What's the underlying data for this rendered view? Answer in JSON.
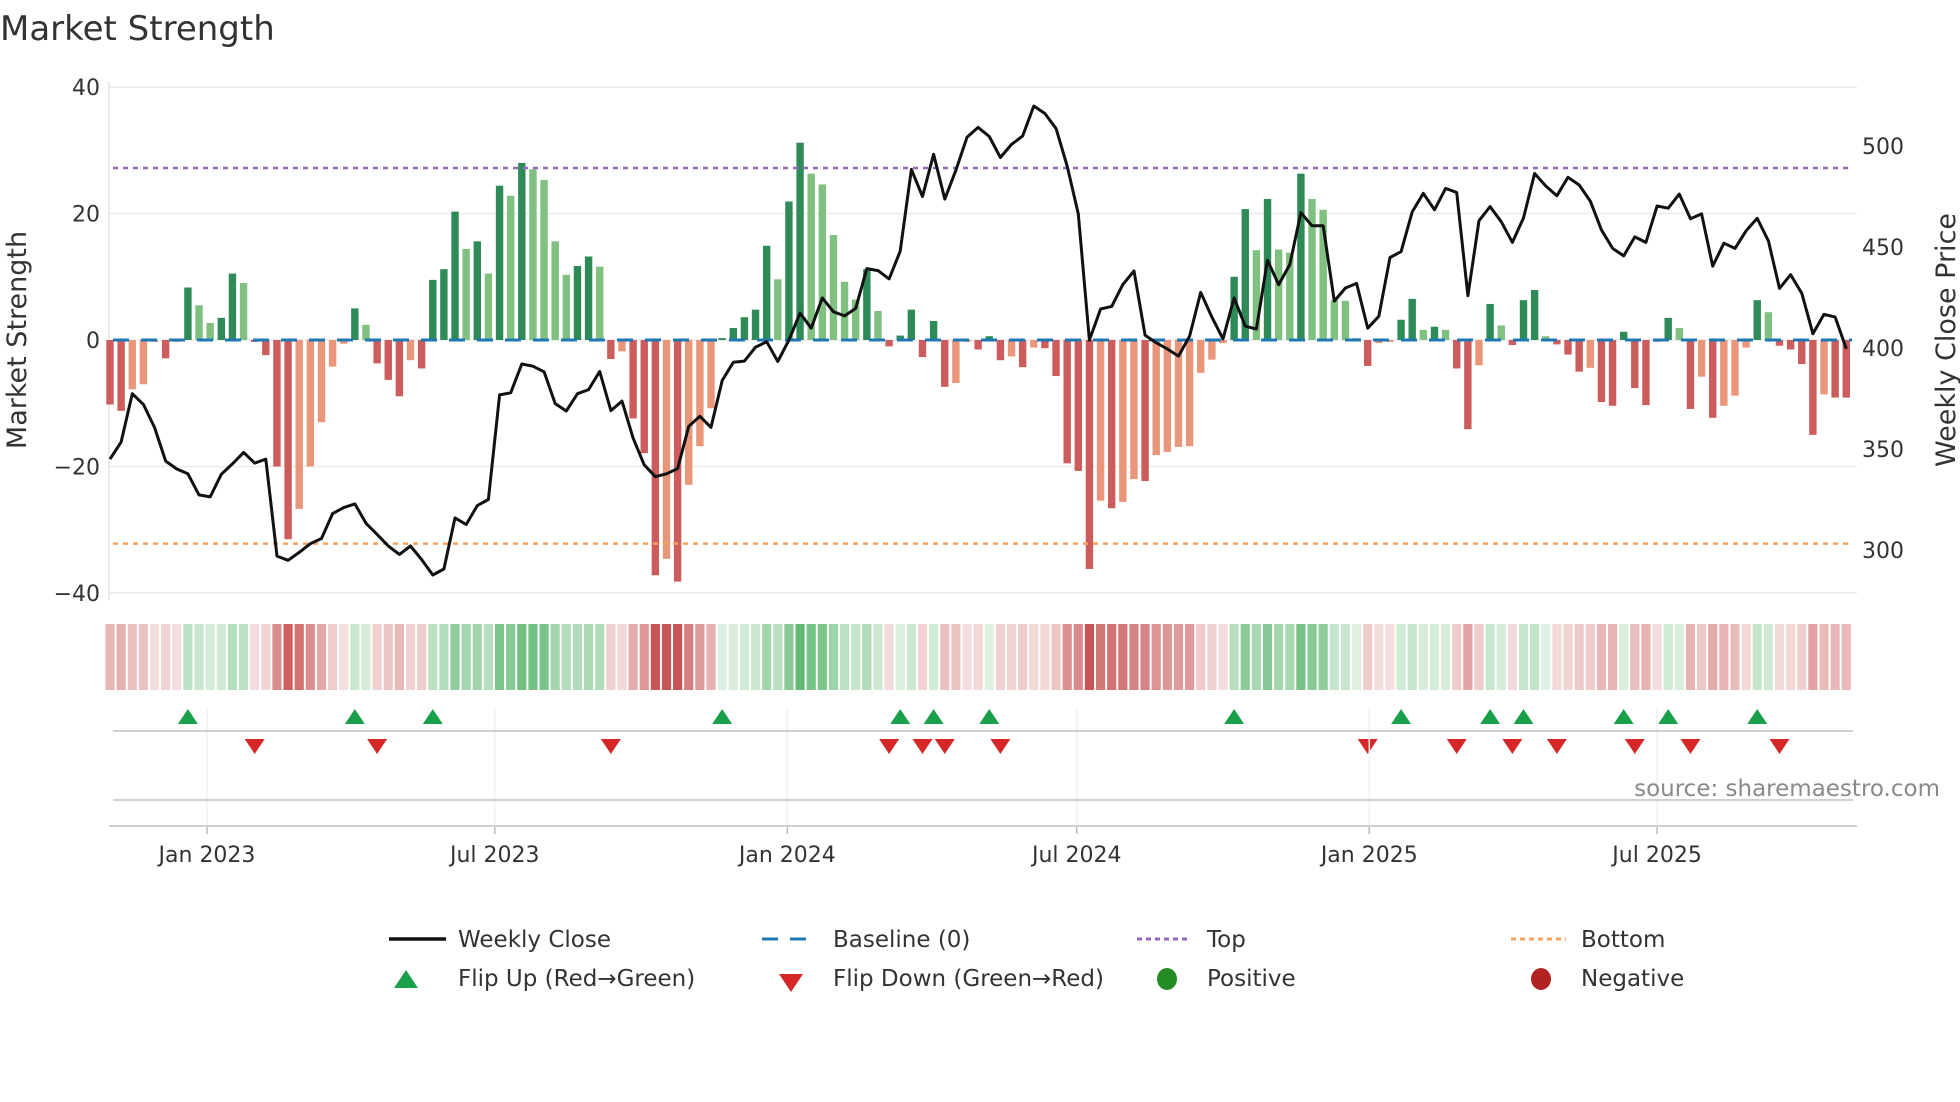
{
  "chart_data": {
    "type": "bar",
    "title": "Market Strength",
    "ylabel": "Market Strength",
    "y2label": "Weekly Close Price",
    "ylim": [
      -42,
      42
    ],
    "y2lim": [
      273,
      523
    ],
    "yticks": [
      40,
      20,
      0,
      -20,
      -40
    ],
    "ytick_labels": [
      "40",
      "20",
      "0",
      "−20",
      "−40"
    ],
    "y2ticks": [
      500,
      450,
      400,
      350,
      300
    ],
    "y2tick_labels": [
      "500",
      "450",
      "400",
      "350",
      "300"
    ],
    "x_start": "2022-11-01",
    "x_step_days": 7,
    "xticks": [
      {
        "date": "2023-01-01",
        "label": "Jan 2023"
      },
      {
        "date": "2023-07-01",
        "label": "Jul 2023"
      },
      {
        "date": "2024-01-01",
        "label": "Jan 2024"
      },
      {
        "date": "2024-07-01",
        "label": "Jul 2024"
      },
      {
        "date": "2025-01-01",
        "label": "Jan 2025"
      },
      {
        "date": "2025-07-01",
        "label": "Jul 2025"
      }
    ],
    "top_level": 27.2,
    "bottom_level": -32.2,
    "baseline": 0,
    "strength": [
      -10.2,
      -11.2,
      -7.8,
      -7.0,
      -0.3,
      -2.9,
      -0.3,
      8.3,
      5.5,
      2.7,
      3.5,
      10.5,
      9.0,
      -0.3,
      -2.4,
      -20,
      -31.5,
      -26.7,
      -20,
      -13,
      -4.2,
      -0.6,
      5.0,
      2.4,
      -3.7,
      -6.3,
      -8.9,
      -3.2,
      -4.5,
      9.5,
      11.2,
      20.3,
      14.4,
      15.6,
      10.5,
      24.4,
      22.8,
      28,
      27,
      25.3,
      15.6,
      10.3,
      11.7,
      13.2,
      11.6,
      -3.0,
      -1.8,
      -12.4,
      -17.9,
      -37.2,
      -34.6,
      -38.2,
      -22.9,
      -16.8,
      -10.8,
      0.3,
      1.9,
      3.6,
      4.8,
      14.9,
      9.6,
      21.9,
      31.2,
      26.3,
      24.6,
      16.6,
      9.2,
      6.4,
      11.2,
      4.6,
      -1.0,
      0.7,
      4.8,
      -2.7,
      3.0,
      -7.4,
      -6.8,
      -0.3,
      -1.5,
      0.6,
      -3.2,
      -2.6,
      -4.3,
      -1.2,
      -1.3,
      -5.7,
      -19.5,
      -20.7,
      -36.2,
      -25.4,
      -26.6,
      -25.6,
      -22,
      -22.3,
      -18.2,
      -17.7,
      -16.9,
      -16.8,
      -5.2,
      -3.1,
      -0.5,
      10,
      20.7,
      14.2,
      22.3,
      14.3,
      13.8,
      26.3,
      22.3,
      20.6,
      6.3,
      6.2,
      0.3,
      -4.1,
      -0.5,
      -0.3,
      3.2,
      6.5,
      1.6,
      2.1,
      1.6,
      -4.5,
      -14.1,
      -4.0,
      5.7,
      2.3,
      -0.8,
      6.3,
      7.9,
      0.6,
      -0.7,
      -2.3,
      -5.0,
      -4.4,
      -9.8,
      -10.4,
      1.3,
      -7.6,
      -10.3,
      -0.3,
      3.5,
      1.9,
      -10.9,
      -5.8,
      -12.3,
      -10.4,
      -8.8,
      -1.2,
      6.3,
      4.4,
      -0.9,
      -1.5,
      -3.8,
      -15.0,
      -8.6,
      -9.1,
      -9.1
    ],
    "weekly_close": [
      345,
      353.4,
      377.4,
      372.1,
      360.7,
      344,
      340.1,
      337.7,
      327.3,
      326.3,
      337.5,
      342.6,
      348.3,
      343,
      345,
      297,
      294.9,
      298.8,
      303.1,
      305.7,
      318,
      321,
      322.8,
      313.2,
      307.7,
      302,
      297.8,
      302,
      295.3,
      287.6,
      290.6,
      315.9,
      312.6,
      322,
      325,
      376.8,
      377.8,
      392.1,
      391,
      388.2,
      372.5,
      368.8,
      377.4,
      379.4,
      388.4,
      369,
      373.7,
      355.4,
      342.2,
      336.3,
      337.7,
      340.3,
      361.3,
      366.2,
      360.7,
      383.9,
      392.9,
      393.5,
      400.4,
      403.1,
      393.3,
      403.9,
      417.3,
      409.8,
      424.8,
      417.9,
      415.9,
      419.6,
      439.3,
      438.3,
      434.2,
      447.9,
      488.4,
      475,
      495.9,
      473.7,
      488,
      504.3,
      509.2,
      504.7,
      494.3,
      500.8,
      505,
      519.8,
      516.1,
      508.6,
      490,
      466.4,
      403.9,
      419.3,
      420.6,
      431.4,
      438.1,
      406.3,
      402.6,
      399.5,
      396,
      405.9,
      427.5,
      415.3,
      404.5,
      424.8,
      410.8,
      409.4,
      443.4,
      431.4,
      441.3,
      467,
      460.5,
      460.5,
      423.2,
      429.7,
      432,
      409.8,
      415.7,
      444.8,
      447.7,
      467.4,
      476.6,
      468.4,
      479,
      477,
      425.9,
      463,
      470,
      462.5,
      452.3,
      464.4,
      486.4,
      480.2,
      475.4,
      484.5,
      480.7,
      472.7,
      458.5,
      449.3,
      445.6,
      455,
      452.3,
      470.3,
      469.2,
      476.2,
      464,
      466.4,
      440.5,
      451.9,
      449.3,
      458,
      464.2,
      453,
      429.5,
      436.3,
      427.1,
      407.1,
      416.7,
      415.3,
      399.6
    ],
    "legend": {
      "placement": "bottom",
      "items": [
        {
          "label": "Weekly Close",
          "symbol": "line"
        },
        {
          "label": "Baseline (0)",
          "symbol": "dash"
        },
        {
          "label": "Top",
          "symbol": "dot"
        },
        {
          "label": "Bottom",
          "symbol": "dot"
        },
        {
          "label": "Flip Up (Red→Green)",
          "symbol": "triangle-up"
        },
        {
          "label": "Flip Down (Green→Red)",
          "symbol": "triangle-down"
        },
        {
          "label": "Positive",
          "symbol": "circle"
        },
        {
          "label": "Negative",
          "symbol": "circle"
        }
      ]
    },
    "colors": {
      "pos_rising": "#2e8b57",
      "pos_falling": "#80c080",
      "neg_rising": "#cd5c5c",
      "neg_falling": "#e9967a",
      "baseline": "#1f77b4",
      "top": "#9467bd",
      "bottom": "#f4a460",
      "close": "#111111",
      "flip_up": "#1a9f4a",
      "flip_down": "#d62728",
      "positive": "#228b22",
      "negative": "#b22222"
    },
    "source": "source: sharemaestro.com"
  }
}
